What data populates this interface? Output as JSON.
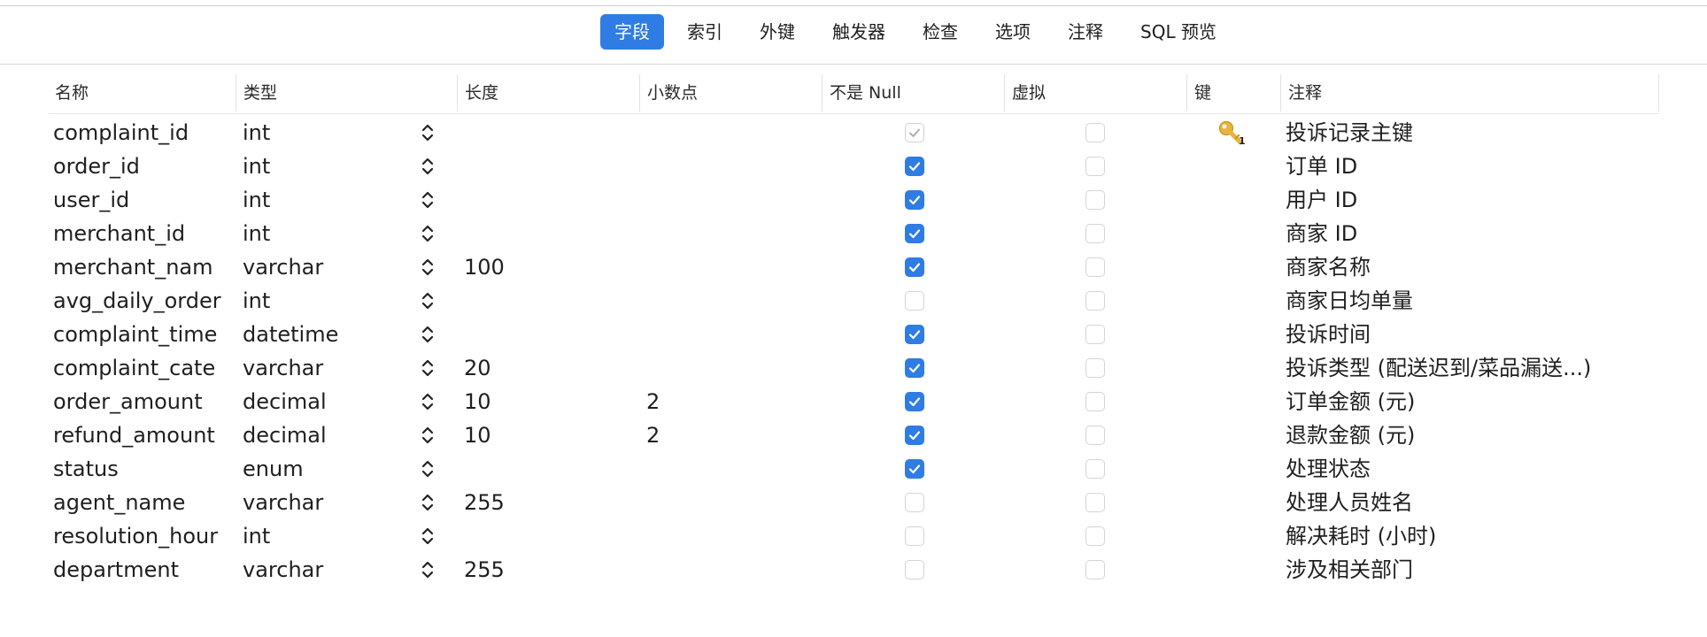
{
  "tabs": [
    {
      "label": "字段",
      "active": true
    },
    {
      "label": "索引",
      "active": false
    },
    {
      "label": "外键",
      "active": false
    },
    {
      "label": "触发器",
      "active": false
    },
    {
      "label": "检查",
      "active": false
    },
    {
      "label": "选项",
      "active": false
    },
    {
      "label": "注释",
      "active": false
    },
    {
      "label": "SQL 预览",
      "active": false
    }
  ],
  "columns": {
    "name": "名称",
    "type": "类型",
    "length": "长度",
    "decimals": "小数点",
    "not_null": "不是 Null",
    "virtual": "虚拟",
    "key": "键",
    "comment": "注释"
  },
  "colors": {
    "accent": "#2f7ce4",
    "key_icon": "#e8b53c"
  },
  "rows": [
    {
      "name": "complaint_id",
      "type": "int",
      "length": "",
      "decimals": "",
      "not_null": "disabled-checked",
      "virtual": false,
      "key": "key-icon",
      "comment": "投诉记录主键"
    },
    {
      "name": "order_id",
      "type": "int",
      "length": "",
      "decimals": "",
      "not_null": "checked",
      "virtual": false,
      "key": "",
      "comment": "订单 ID"
    },
    {
      "name": "user_id",
      "type": "int",
      "length": "",
      "decimals": "",
      "not_null": "checked",
      "virtual": false,
      "key": "",
      "comment": "用户 ID"
    },
    {
      "name": "merchant_id",
      "type": "int",
      "length": "",
      "decimals": "",
      "not_null": "checked",
      "virtual": false,
      "key": "",
      "comment": "商家 ID"
    },
    {
      "name": "merchant_nam",
      "type": "varchar",
      "length": "100",
      "decimals": "",
      "not_null": "checked",
      "virtual": false,
      "key": "",
      "comment": "商家名称"
    },
    {
      "name": "avg_daily_order",
      "type": "int",
      "length": "",
      "decimals": "",
      "not_null": "unchecked",
      "virtual": false,
      "key": "",
      "comment": "商家日均单量"
    },
    {
      "name": "complaint_time",
      "type": "datetime",
      "length": "",
      "decimals": "",
      "not_null": "checked",
      "virtual": false,
      "key": "",
      "comment": "投诉时间"
    },
    {
      "name": "complaint_cate",
      "type": "varchar",
      "length": "20",
      "decimals": "",
      "not_null": "checked",
      "virtual": false,
      "key": "",
      "comment": "投诉类型 (配送迟到/菜品漏送...)"
    },
    {
      "name": "order_amount",
      "type": "decimal",
      "length": "10",
      "decimals": "2",
      "not_null": "checked",
      "virtual": false,
      "key": "",
      "comment": "订单金额 (元)"
    },
    {
      "name": "refund_amount",
      "type": "decimal",
      "length": "10",
      "decimals": "2",
      "not_null": "checked",
      "virtual": false,
      "key": "",
      "comment": "退款金额 (元)"
    },
    {
      "name": "status",
      "type": "enum",
      "length": "",
      "decimals": "",
      "not_null": "checked",
      "virtual": false,
      "key": "",
      "comment": "处理状态"
    },
    {
      "name": "agent_name",
      "type": "varchar",
      "length": "255",
      "decimals": "",
      "not_null": "unchecked",
      "virtual": false,
      "key": "",
      "comment": "处理人员姓名"
    },
    {
      "name": "resolution_hour",
      "type": "int",
      "length": "",
      "decimals": "",
      "not_null": "unchecked",
      "virtual": false,
      "key": "",
      "comment": "解决耗时 (小时)"
    },
    {
      "name": "department",
      "type": "varchar",
      "length": "255",
      "decimals": "",
      "not_null": "unchecked",
      "virtual": false,
      "key": "",
      "comment": "涉及相关部门"
    }
  ]
}
